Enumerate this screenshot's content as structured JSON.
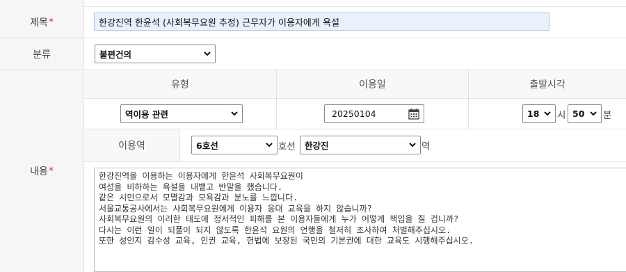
{
  "form": {
    "title_label": "제목",
    "title_value": "한강진역 한윤석 (사회복무요원 추정) 근무자가 이용자에게 욕설",
    "category_label": "분류",
    "category_value": "불편건의",
    "content_label": "내용",
    "required_mark": "*",
    "columns": {
      "type_header": "유형",
      "date_header": "이용일",
      "time_header": "출발시각"
    },
    "type_value": "역이용 관련",
    "date_value": "20250104",
    "hour_value": "18",
    "hour_unit": "시",
    "minute_value": "50",
    "minute_unit": "분",
    "station_label": "이용역",
    "line_value": "6호선",
    "line_unit": "호선",
    "station_value": "한강진",
    "station_unit": "역",
    "content_text": "한강진역을 이용하는 이용자에게 한윤석 사회복무요원이\n여성을 비하하는 욕설을 내뱉고 반말을 했습니다.\n같은 시민으로서 모멸감과 모욕감과 분노를 느낍니다.\n서울교통공사에서는 사회복무요원에게 이용자 응대 교육을 하지 않습니까?\n사회복무요원의 이러한 태도에 정서적인 피해를 본 이용자들에게 누가 어떻게 책임을 질 겁니까?\n다시는 이런 일이 되풀이 되지 않도록 한윤석 요원의 언행을 철저히 조사하여 처벌해주십시오.\n또한 성인지 감수성 교육, 인권 교육, 헌법에 보장된 국민의 기본권에 대한 교육도 시행해주십시오."
  },
  "icons": {
    "dropdown": "chevron-down-icon",
    "calendar": "calendar-icon"
  }
}
